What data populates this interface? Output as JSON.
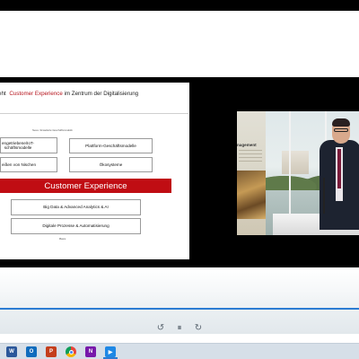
{
  "slide": {
    "title_pre": "eht ",
    "title_highlight": "Customer Experience",
    "title_post": " im Zentrum der Digitalisierung",
    "subtitle": "Neue / Erweiterte Geschäftsmodelle",
    "box_iot": "engetriebene/IoT-\nschäftsmodelle",
    "box_platform": "Plattform-Geschäftsmodelle",
    "box_niche": "eißen von Nischen",
    "box_ecosystems": "Ökosysteme",
    "banner": "Customer Experience",
    "box_bigdata": "Big Data & Advanced Analytics & AI",
    "box_processes": "Digitale Prozesse & Automatisierung",
    "footer": "Basis"
  },
  "camera": {
    "wall_title": "nagement"
  },
  "player": {
    "progress_fraction": 1.0,
    "controls": {
      "rewind_icon": "rewind-10-icon",
      "pause_icon": "pause-icon",
      "forward_icon": "forward-10-icon",
      "rewind_glyph": "↺",
      "pause_glyph": "⏸",
      "forward_glyph": "↻"
    }
  },
  "taskbar": {
    "apps": [
      {
        "name": "word-icon",
        "label": "W",
        "color": "#2b579a"
      },
      {
        "name": "outlook-icon",
        "label": "O",
        "color": "#0f6cbd"
      },
      {
        "name": "powerpoint-icon",
        "label": "P",
        "color": "#c43e1c"
      },
      {
        "name": "chrome-icon",
        "label": "",
        "color": "#e8453c"
      },
      {
        "name": "onenote-icon",
        "label": "N",
        "color": "#7719aa"
      },
      {
        "name": "media-player-icon",
        "label": "▶",
        "color": "#1e88e5"
      }
    ]
  }
}
